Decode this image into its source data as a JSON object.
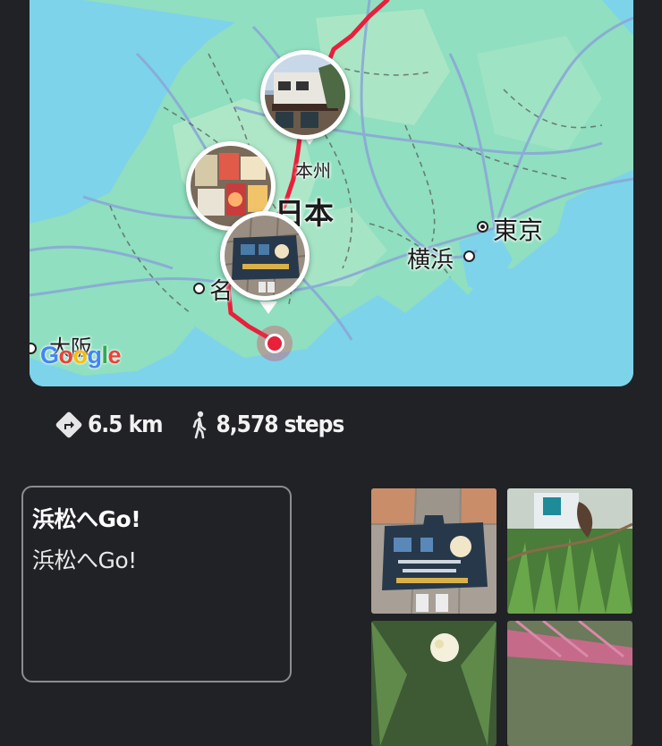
{
  "map": {
    "labels": {
      "honshu": "本州",
      "nihon": "日本",
      "tokyo": "東京",
      "yokohama": "横浜",
      "nagoya": "名",
      "osaka": "大阪"
    },
    "route_color": "#e8203b",
    "google_logo": [
      "G",
      "o",
      "o",
      "g",
      "l",
      "e"
    ],
    "google_colors": [
      "#4285f4",
      "#ea4335",
      "#fbbc05",
      "#4285f4",
      "#34a853",
      "#ea4335"
    ]
  },
  "stats": {
    "distance": "6.5 km",
    "steps": "8,578 steps",
    "distance_icon": "directions-icon",
    "steps_icon": "walking-icon"
  },
  "note": {
    "title": "浜松へGo!",
    "body": "浜松へGo!"
  },
  "photos": [
    {
      "name": "photo-spot-mat"
    },
    {
      "name": "roadside-plants"
    },
    {
      "name": "white-flower"
    },
    {
      "name": "pink-flower"
    }
  ]
}
